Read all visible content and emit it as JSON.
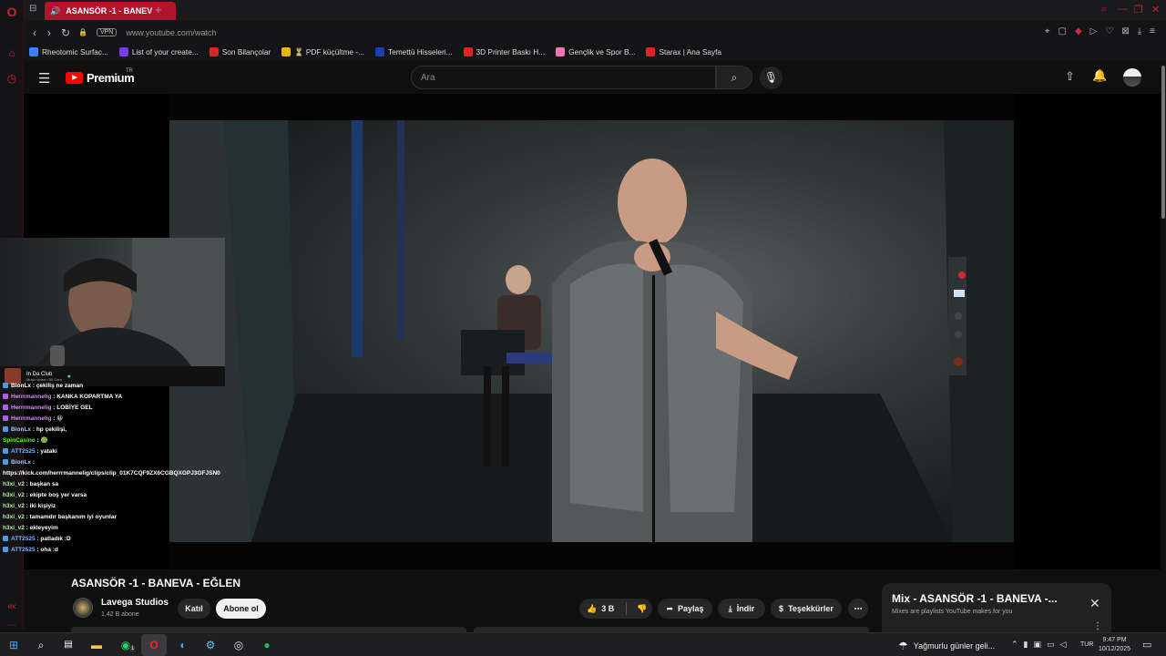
{
  "browser": {
    "tab_title": "ASANSÖR -1 - BANEV",
    "tab_add": "+",
    "vpn_label": "VPN",
    "url": "www.youtube.com/watch",
    "bookmarks": [
      {
        "label": "Rheotomic Surfac...",
        "icon": "globe-icon",
        "color": "#3b82f6"
      },
      {
        "label": "List of your create...",
        "icon": "grid-icon",
        "color": "#7c3aed"
      },
      {
        "label": "Son Bilançolar",
        "icon": "f-icon",
        "color": "#dc2626"
      },
      {
        "label": "⏳ PDF küçültme -...",
        "icon": "pdf-icon",
        "color": "#eab308"
      },
      {
        "label": "Temettü Hisseleri...",
        "icon": "bars-icon",
        "color": "#1e40af"
      },
      {
        "label": "3D Printer Baskı H...",
        "icon": "3d-icon",
        "color": "#dc2626"
      },
      {
        "label": "Gençlik ve Spor B...",
        "icon": "link-icon",
        "color": "#f472b6"
      },
      {
        "label": "Starax | Ana Sayfa",
        "icon": "arrow-icon",
        "color": "#dc2626"
      }
    ]
  },
  "youtube": {
    "logo_text": "Premium",
    "region": "TR",
    "search_placeholder": "Ara"
  },
  "webcam": {
    "channel_title": "In Da Club",
    "channel_sub": "Music video • 50 Cent"
  },
  "chat": [
    {
      "user": "BionLx",
      "msg": "çekiliş ne zaman",
      "color": "#ffffff",
      "badge": "b"
    },
    {
      "user": "Herrrmannelig",
      "msg": "KANKA KOPARTMA YA",
      "color": "#d58cff",
      "badge": "p"
    },
    {
      "user": "Herrrmannelig",
      "msg": "LOBİYE GEL",
      "color": "#d58cff",
      "badge": "p"
    },
    {
      "user": "Herrrmannelig",
      "msg": "😀",
      "color": "#d58cff",
      "badge": "p"
    },
    {
      "user": "BionLx",
      "msg": "hp çekilişi,",
      "color": "#9ecbff",
      "badge": "b"
    },
    {
      "user": "SpinCasino",
      "msg": "🟢",
      "color": "#53fc18",
      "badge": ""
    },
    {
      "user": "ATT2525",
      "msg": "yataki",
      "color": "#7ab8ff",
      "badge": "b"
    },
    {
      "user": "BionLx",
      "msg": "",
      "color": "#9ecbff",
      "badge": "b"
    },
    {
      "user": "",
      "msg": "https://kick.com/herrrmannelig/clips/clip_01K7CQF9ZX6CGBQXGPJ3GFJSN0",
      "color": "#ffffff",
      "badge": ""
    },
    {
      "user": "h3xi_v2",
      "msg": "başkan sa",
      "color": "#b6f0a0",
      "badge": ""
    },
    {
      "user": "h3xi_v2",
      "msg": "ekipte boş yer varsa",
      "color": "#b6f0a0",
      "badge": ""
    },
    {
      "user": "h3xi_v2",
      "msg": "iki kişiyiz",
      "color": "#b6f0a0",
      "badge": ""
    },
    {
      "user": "h3xi_v2",
      "msg": "tamamdır başkanım iyi oyunlar",
      "color": "#b6f0a0",
      "badge": ""
    },
    {
      "user": "h3xi_v2",
      "msg": "ekleyeyim",
      "color": "#b6f0a0",
      "badge": ""
    },
    {
      "user": "ATT2525",
      "msg": "patladık :D",
      "color": "#7ab8ff",
      "badge": "b"
    },
    {
      "user": "ATT2525",
      "msg": "oha :d",
      "color": "#7ab8ff",
      "badge": "b"
    }
  ],
  "video": {
    "title": "ASANSÖR -1 - BANEVA - EĞLEN",
    "channel": "Lavega Studios",
    "subscribers": "1,42 B abone",
    "join_label": "Katıl",
    "subscribe_label": "Abone ol",
    "likes": "3 B",
    "share_label": "Paylaş",
    "download_label": "İndir",
    "thanks_label": "Teşekkürler",
    "more_label": "⋯"
  },
  "mix": {
    "title": "Mix - ASANSÖR -1 - BANEVA -...",
    "subtitle": "Mixes are playlists YouTube makes for you"
  },
  "taskbar": {
    "weather": "Yağmurlu günler geli...",
    "lang": "TUR",
    "time": "9:47 PM",
    "date": "10/12/2025",
    "whatsapp_badge": "1"
  }
}
